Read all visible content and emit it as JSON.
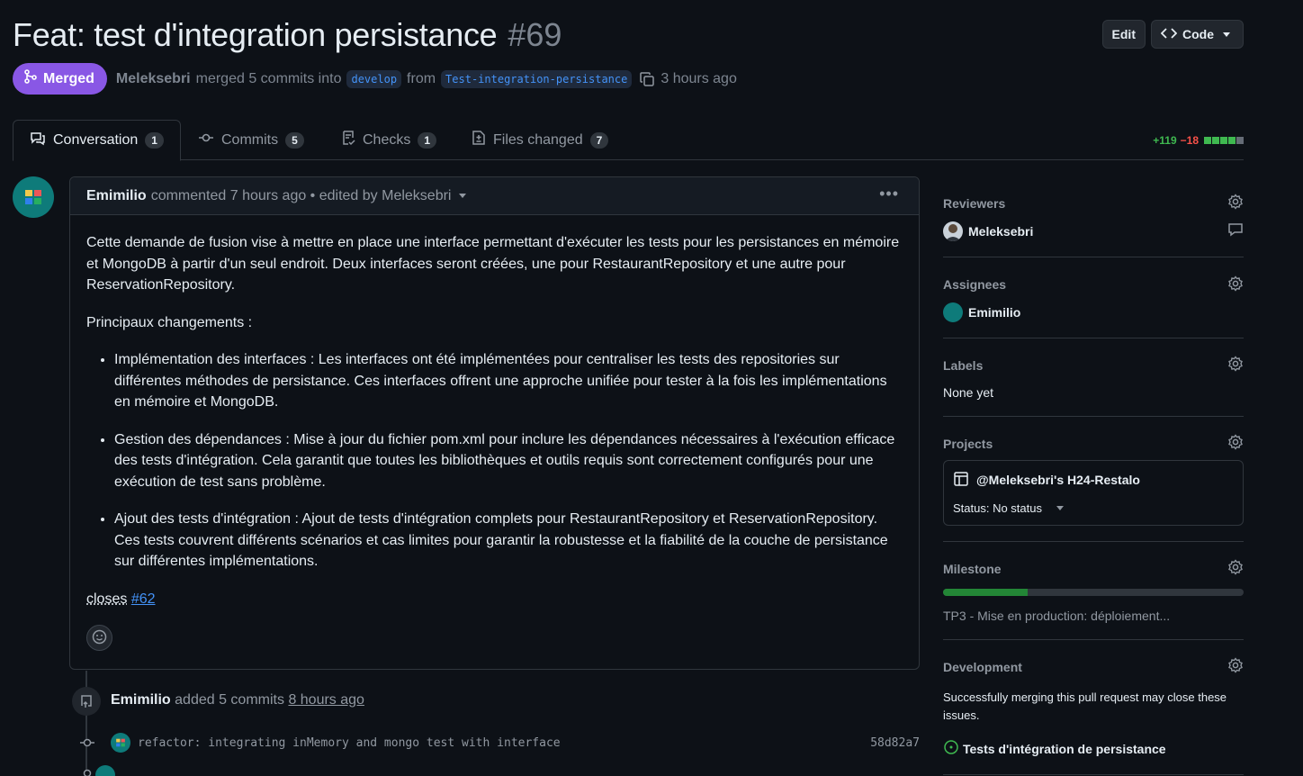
{
  "pr": {
    "title": "Feat: test d'integration persistance",
    "number": "#69",
    "status": "Merged",
    "author": "Meleksebri",
    "merge_text": "merged 5 commits into",
    "base_branch": "develop",
    "from_text": "from",
    "head_branch": "Test-integration-persistance",
    "time": "3 hours ago"
  },
  "header_buttons": {
    "edit": "Edit",
    "code": "Code"
  },
  "tabs": [
    {
      "label": "Conversation",
      "count": "1"
    },
    {
      "label": "Commits",
      "count": "5"
    },
    {
      "label": "Checks",
      "count": "1"
    },
    {
      "label": "Files changed",
      "count": "7"
    }
  ],
  "diffstat": {
    "additions": "+119",
    "deletions": "−18"
  },
  "comment": {
    "author": "Emimilio",
    "meta": "commented 7 hours ago • edited by Meleksebri",
    "intro": "Cette demande de fusion vise à mettre en place une interface permettant d'exécuter les tests pour les persistances en mémoire et MongoDB à partir d'un seul endroit. Deux interfaces seront créées, une pour RestaurantRepository et une autre pour ReservationRepository.",
    "changes_heading": "Principaux changements :",
    "bullets": [
      "Implémentation des interfaces : Les interfaces ont été implémentées pour centraliser les tests des repositories sur différentes méthodes de persistance. Ces interfaces offrent une approche unifiée pour tester à la fois les implémentations en mémoire et MongoDB.",
      "Gestion des dépendances : Mise à jour du fichier pom.xml pour inclure les dépendances nécessaires à l'exécution efficace des tests d'intégration. Cela garantit que toutes les bibliothèques et outils requis sont correctement configurés pour une exécution de test sans problème.",
      "Ajout des tests d'intégration : Ajout de tests d'intégration complets pour RestaurantRepository et ReservationRepository. Ces tests couvrent différents scénarios et cas limites pour garantir la robustesse et la fiabilité de la couche de persistance sur différentes implémentations."
    ],
    "closes_label": "closes",
    "closes_link": "#62"
  },
  "timeline": {
    "author": "Emimilio",
    "action": "added 5 commits",
    "time": "8 hours ago",
    "commits": [
      {
        "message": "refactor: integrating inMemory and mongo test with interface",
        "sha": "58d82a7"
      }
    ]
  },
  "sidebar": {
    "reviewers": {
      "title": "Reviewers",
      "name": "Meleksebri"
    },
    "assignees": {
      "title": "Assignees",
      "name": "Emimilio"
    },
    "labels": {
      "title": "Labels",
      "value": "None yet"
    },
    "projects": {
      "title": "Projects",
      "name": "@Meleksebri's H24-Restalo",
      "status": "Status: No status"
    },
    "milestone": {
      "title": "Milestone",
      "name": "TP3 - Mise en production: déploiement...",
      "progress": 0.28
    },
    "development": {
      "title": "Development",
      "text": "Successfully merging this pull request may close these issues.",
      "issue": "Tests d'intégration de persistance"
    }
  },
  "colors": {
    "merged": "#8957e5",
    "accent": "#4493f8",
    "success": "#3fb950",
    "danger": "#f85149"
  }
}
